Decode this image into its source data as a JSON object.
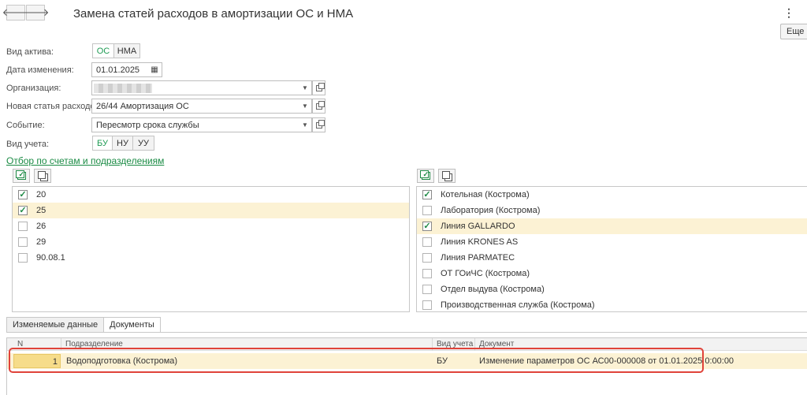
{
  "header": {
    "back_icon": "arrow-left-icon",
    "forward_icon": "arrow-right-icon",
    "back": "🡐",
    "forward": "🡒",
    "title": "Замена статей расходов в амортизации ОС и НМА",
    "more_menu": "⋮",
    "more_label": "Еще"
  },
  "form": {
    "asset_type_label": "Вид актива:",
    "asset_type_options": [
      "ОС",
      "НМА"
    ],
    "asset_type_selected": "ОС",
    "change_date_label": "Дата изменения:",
    "change_date_value": "01.01.2025",
    "organization_label": "Организация:",
    "organization_value": "",
    "new_expense_label": "Новая статья расходов:",
    "new_expense_value": "26/44 Амортизация ОС",
    "event_label": "Событие:",
    "event_value": "Пересмотр срока службы",
    "accounting_type_label": "Вид учета:",
    "accounting_type_options": [
      "БУ",
      "НУ",
      "УУ"
    ],
    "accounting_type_selected": "БУ"
  },
  "filter_link": "Отбор по счетам и подразделениям",
  "accounts": [
    {
      "label": "20",
      "checked": true,
      "selected": false
    },
    {
      "label": "25",
      "checked": true,
      "selected": true
    },
    {
      "label": "26",
      "checked": false,
      "selected": false
    },
    {
      "label": "29",
      "checked": false,
      "selected": false
    },
    {
      "label": "90.08.1",
      "checked": false,
      "selected": false
    }
  ],
  "departments": [
    {
      "label": "Котельная (Кострома)",
      "checked": true,
      "selected": false
    },
    {
      "label": "Лаборатория (Кострома)",
      "checked": false,
      "selected": false
    },
    {
      "label": "Линия GALLARDO",
      "checked": true,
      "selected": true
    },
    {
      "label": "Линия KRONES AS",
      "checked": false,
      "selected": false
    },
    {
      "label": "Линия PARMATEC",
      "checked": false,
      "selected": false
    },
    {
      "label": "ОТ ГОиЧС (Кострома)",
      "checked": false,
      "selected": false
    },
    {
      "label": "Отдел выдува (Кострома)",
      "checked": false,
      "selected": false
    },
    {
      "label": "Производственная служба (Кострома)",
      "checked": false,
      "selected": false
    }
  ],
  "tabs": [
    "Изменяемые данные",
    "Документы"
  ],
  "active_tab": "Документы",
  "table": {
    "columns": [
      "N",
      "Подразделение",
      "Вид учета",
      "Документ"
    ],
    "rows": [
      {
        "n": "1",
        "department": "Водоподготовка (Кострома)",
        "accounting": "БУ",
        "document": "Изменение параметров ОС АС00-000008 от 01.01.2025 0:00:00"
      }
    ]
  },
  "colors": {
    "accent": "#1f9b54",
    "selection": "#fcf2d4",
    "highlight_border": "#e0433a"
  }
}
